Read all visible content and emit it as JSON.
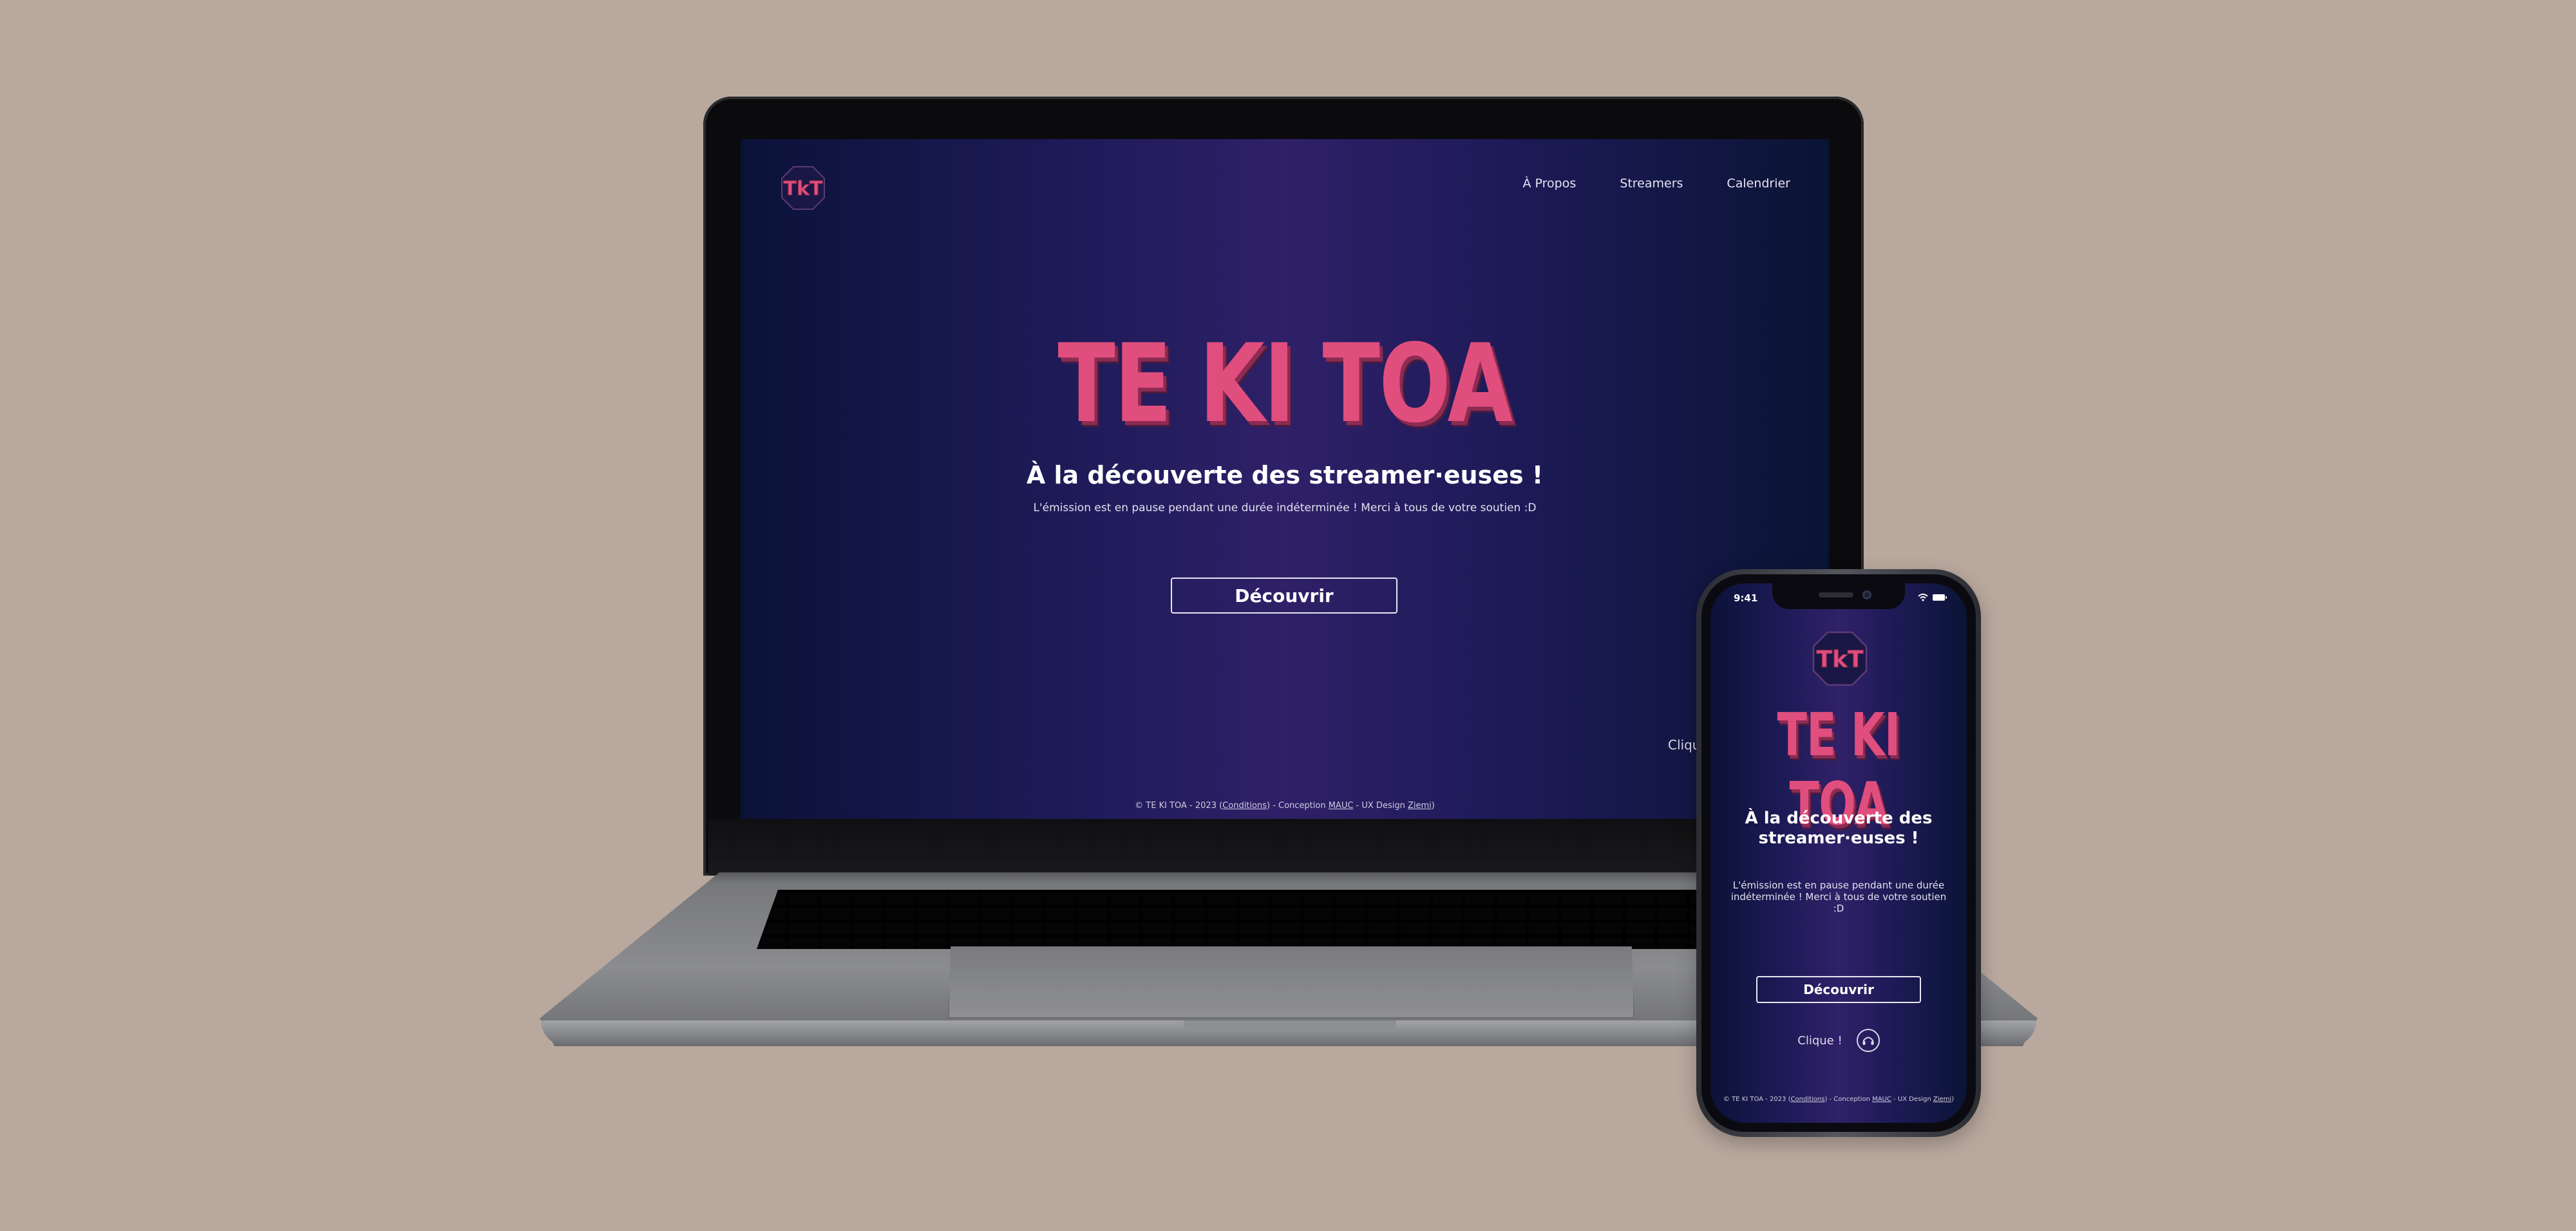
{
  "site": {
    "title": "TE KI TOA",
    "logo_text": "TKT",
    "subtitle": "À la découverte des streamer·euses !",
    "notice": "L'émission est en pause pendant une durée indéterminée ! Merci à tous de votre soutien :D",
    "cta_label": "Découvrir",
    "clique_label": "Clique !",
    "clique_partial_label": "Cliqu",
    "nav": [
      {
        "label": "À Propos"
      },
      {
        "label": "Streamers"
      },
      {
        "label": "Calendrier"
      }
    ],
    "footer": {
      "prefix": "© TE KI TOA - 2023 (",
      "conditions": "Conditions",
      "middle": ") - Conception ",
      "designer": "MAUC",
      "ux_prefix": " - UX Design ",
      "ux_designer": "Ziemi",
      "suffix": ")"
    }
  },
  "phone_status": {
    "time": "9:41"
  },
  "colors": {
    "background": "#b9a89e",
    "title_pink": "#e04e7e",
    "title_shadow": "#8d2b52",
    "screen_gradient_center": "#302168",
    "screen_gradient_edge": "#0b1238",
    "text_white": "#ffffff"
  },
  "icons": {
    "logo": "tkt-octagon-logo-icon",
    "wifi": "wifi-icon",
    "battery": "battery-icon",
    "clique": "headphones-icon"
  }
}
